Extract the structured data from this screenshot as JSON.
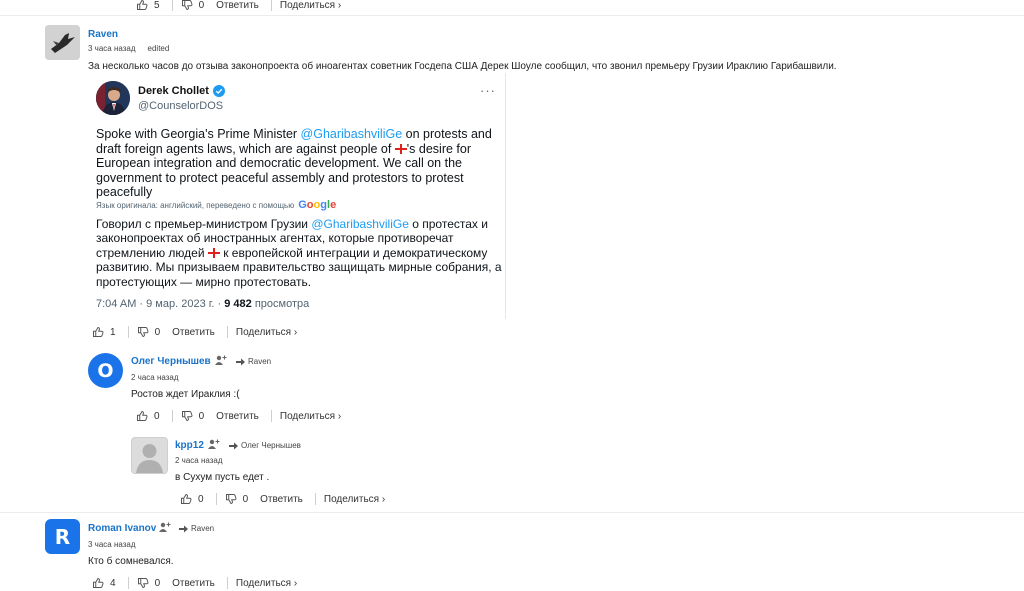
{
  "top_actions": {
    "likes": "5",
    "dislikes": "0",
    "reply_label": "Ответить",
    "share_label": "Поделиться ›"
  },
  "comments": [
    {
      "author": "Raven",
      "time": "3 часа назад",
      "edited": "edited",
      "text": "За несколько часов до отзыва законопроекта об иноагентах советник Госдепа США Дерек Шоуле сообщил, что звонил премьеру Грузии Ираклию Гарибашвили.",
      "likes": "1",
      "dislikes": "0",
      "reply_label": "Ответить",
      "share_label": "Поделиться ›"
    },
    {
      "author": "Олег Чернышев",
      "reply_to": "Raven",
      "avatar_letter": "О",
      "avatar_color": "#1a73e8",
      "time": "2 часа назад",
      "text": "Ростов ждет Ираклия :(",
      "likes": "0",
      "dislikes": "0",
      "reply_label": "Ответить",
      "share_label": "Поделиться ›"
    },
    {
      "author": "kpp12",
      "reply_to": "Олег Чернышев",
      "time": "2 часа назад",
      "text": "в Сухум пусть едет .",
      "likes": "0",
      "dislikes": "0",
      "reply_label": "Ответить",
      "share_label": "Поделиться ›"
    },
    {
      "author": "Roman Ivanov",
      "reply_to": "Raven",
      "avatar_letter": "R",
      "avatar_color": "#1a73e8",
      "time": "3 часа назад",
      "text": "Кто б сомневался.",
      "likes": "4",
      "dislikes": "0",
      "reply_label": "Ответить",
      "share_label": "Поделиться ›"
    }
  ],
  "tweet": {
    "name": "Derek Chollet",
    "handle": "@CounselorDOS",
    "more": "···",
    "en_before": "Spoke with Georgia's Prime Minister ",
    "mention": "@GharibashviliGe",
    "en_mid": " on protests and draft foreign agents laws, which are against people of ",
    "en_after": "'s desire for European integration and democratic development. We call on the government to protect peaceful assembly and protestors to protest peacefully",
    "lang_note": "Язык оригинала: английский, переведено с помощью",
    "google": "Google",
    "ru_before": "Говорил с премьер-министром Грузии ",
    "ru_mention": "@GharibashviliGe",
    "ru_mid": " о протестах и законопроектах об иностранных агентах, которые противоречат стремлению людей ",
    "ru_after": " к европейской интеграции и демократическому развитию. Мы призываем правительство защищать мирные собрания, а протестующих — мирно протестовать.",
    "timestamp": "7:04 AM · 9 мар. 2023 г. · ",
    "views": "9 482",
    "views_label": " просмотра"
  },
  "colors": {
    "link": "#1a73c8",
    "tweet_link": "#1d9bf0",
    "avatar_blue": "#1a73e8"
  }
}
